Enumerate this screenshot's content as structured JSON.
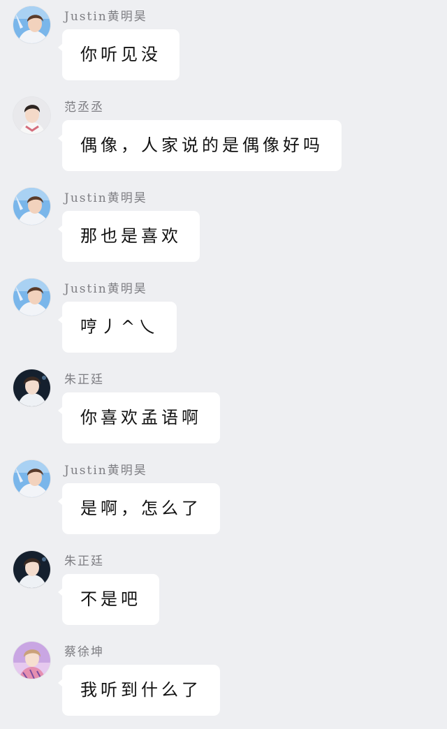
{
  "messages": [
    {
      "sender": "Justin黄明昊",
      "text": "你听见没",
      "avatar": "justin-avatar-icon"
    },
    {
      "sender": "范丞丞",
      "text": "偶像，人家说的是偶像好吗",
      "avatar": "fan-avatar-icon"
    },
    {
      "sender": "Justin黄明昊",
      "text": "那也是喜欢",
      "avatar": "justin-avatar-icon"
    },
    {
      "sender": "Justin黄明昊",
      "text": "哼丿^乀",
      "avatar": "justin-avatar-icon"
    },
    {
      "sender": "朱正廷",
      "text": "你喜欢孟语啊",
      "avatar": "zhu-avatar-icon"
    },
    {
      "sender": "Justin黄明昊",
      "text": "是啊，怎么了",
      "avatar": "justin-avatar-icon"
    },
    {
      "sender": "朱正廷",
      "text": "不是吧",
      "avatar": "zhu-avatar-icon"
    },
    {
      "sender": "蔡徐坤",
      "text": "我听到什么了",
      "avatar": "cai-avatar-icon"
    }
  ],
  "colors": {
    "background": "#eeeff2",
    "bubble": "#ffffff",
    "sender_text": "#7d7d82",
    "message_text": "#111111"
  }
}
